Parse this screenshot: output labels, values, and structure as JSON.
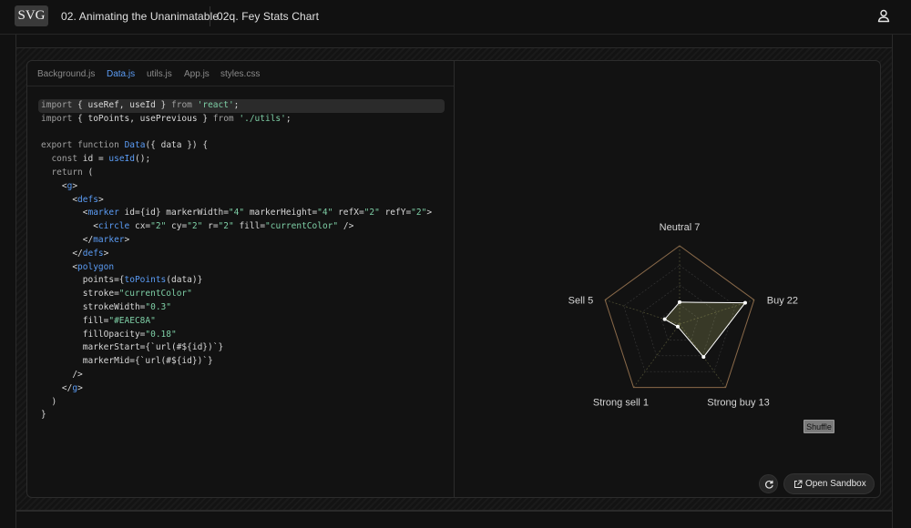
{
  "header": {
    "logo": "SVG",
    "breadcrumb_lesson": "02. Animating the Unanimatable",
    "breadcrumb_exercise": "02q. Fey Stats Chart",
    "user_icon": "user-icon"
  },
  "editor": {
    "tabs": [
      {
        "label": "Background.js",
        "active": false
      },
      {
        "label": "Data.js",
        "active": true
      },
      {
        "label": "utils.js",
        "active": false
      },
      {
        "label": "App.js",
        "active": false
      },
      {
        "label": "styles.css",
        "active": false
      }
    ],
    "code_lines": [
      "import { useRef, useId } from 'react';",
      "import { toPoints, usePrevious } from './utils';",
      "",
      "export function Data({ data }) {",
      "  const id = useId();",
      "  return (",
      "    <g>",
      "      <defs>",
      "        <marker id={id} markerWidth=\"4\" markerHeight=\"4\" refX=\"2\" refY=\"2\">",
      "          <circle cx=\"2\" cy=\"2\" r=\"2\" fill=\"currentColor\" />",
      "        </marker>",
      "      </defs>",
      "      <polygon",
      "        points={toPoints(data)}",
      "        stroke=\"currentColor\"",
      "        strokeWidth=\"0.3\"",
      "        fill=\"#EAEC8A\"",
      "        fillOpacity=\"0.18\"",
      "        markerStart={`url(#${id})`}",
      "        markerMid={`url(#${id})`}",
      "      />",
      "    </g>",
      "  )",
      "}"
    ]
  },
  "chart_data": {
    "type": "radar",
    "axes": [
      "Neutral",
      "Buy",
      "Strong buy",
      "Strong sell",
      "Sell"
    ],
    "values": [
      7,
      22,
      13,
      1,
      5
    ],
    "labels": [
      "Neutral 7",
      "Buy 22",
      "Strong buy 13",
      "Strong sell 1",
      "Sell 5"
    ],
    "max": 25,
    "colors": {
      "outline": "#8a6a4a",
      "fill": "#EAEC8A",
      "stroke": "#ffffff",
      "grid": "#4a4a30"
    }
  },
  "preview": {
    "shuffle_label": "Shuffle",
    "open_sandbox_label": "Open Sandbox",
    "refresh_icon": "refresh-icon",
    "external_link_icon": "external-link-icon"
  }
}
